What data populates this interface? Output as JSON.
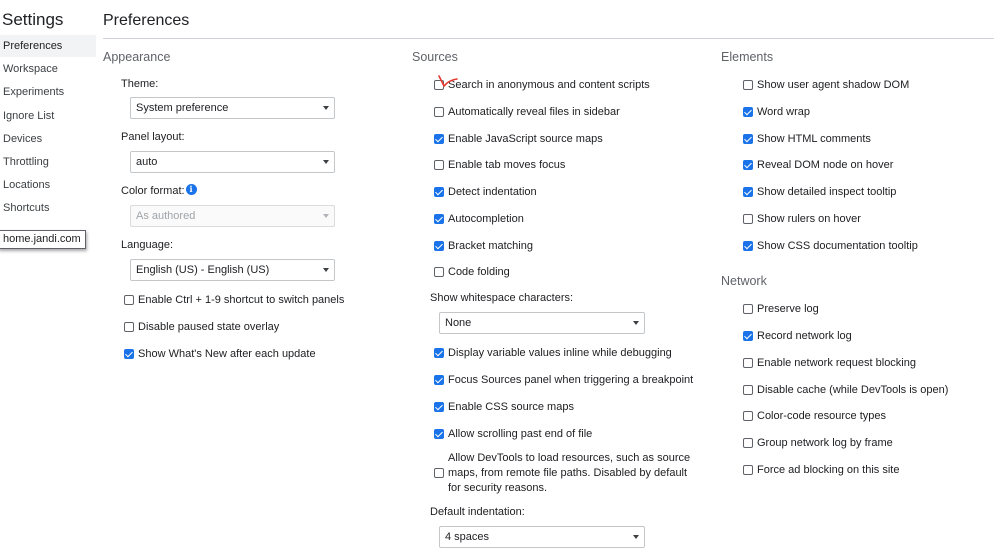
{
  "sidebar": {
    "title": "Settings",
    "items": [
      {
        "label": "Preferences",
        "selected": true
      },
      {
        "label": "Workspace"
      },
      {
        "label": "Experiments"
      },
      {
        "label": "Ignore List"
      },
      {
        "label": "Devices"
      },
      {
        "label": "Throttling"
      },
      {
        "label": "Locations"
      },
      {
        "label": "Shortcuts"
      }
    ],
    "tooltip": "home.jandi.com"
  },
  "page": {
    "title": "Preferences"
  },
  "appearance": {
    "title": "Appearance",
    "theme": {
      "label": "Theme:",
      "value": "System preference"
    },
    "panel_layout": {
      "label": "Panel layout:",
      "value": "auto"
    },
    "color_format": {
      "label": "Color format:",
      "value": "As authored",
      "disabled": true
    },
    "language": {
      "label": "Language:",
      "value": "English (US) - English (US)"
    },
    "checkboxes": [
      {
        "label": "Enable Ctrl + 1-9 shortcut to switch panels",
        "checked": false
      },
      {
        "label": "Disable paused state overlay",
        "checked": false
      },
      {
        "label": "Show What's New after each update",
        "checked": true
      }
    ]
  },
  "sources": {
    "title": "Sources",
    "checkboxes": [
      {
        "label": "Search in anonymous and content scripts",
        "checked": false
      },
      {
        "label": "Automatically reveal files in sidebar",
        "checked": false
      },
      {
        "label": "Enable JavaScript source maps",
        "checked": true
      },
      {
        "label": "Enable tab moves focus",
        "checked": false
      },
      {
        "label": "Detect indentation",
        "checked": true
      },
      {
        "label": "Autocompletion",
        "checked": true
      },
      {
        "label": "Bracket matching",
        "checked": true
      },
      {
        "label": "Code folding",
        "checked": false
      }
    ],
    "whitespace": {
      "label": "Show whitespace characters:",
      "value": "None"
    },
    "checkboxes2": [
      {
        "label": "Display variable values inline while debugging",
        "checked": true
      },
      {
        "label": "Focus Sources panel when triggering a breakpoint",
        "checked": true
      },
      {
        "label": "Enable CSS source maps",
        "checked": true
      },
      {
        "label": "Allow scrolling past end of file",
        "checked": true
      },
      {
        "label": "Allow DevTools to load resources, such as source maps, from remote file paths. Disabled by default for security reasons.",
        "checked": false
      }
    ],
    "indentation": {
      "label": "Default indentation:",
      "value": "4 spaces"
    }
  },
  "elements": {
    "title": "Elements",
    "checkboxes": [
      {
        "label": "Show user agent shadow DOM",
        "checked": false
      },
      {
        "label": "Word wrap",
        "checked": true
      },
      {
        "label": "Show HTML comments",
        "checked": true
      },
      {
        "label": "Reveal DOM node on hover",
        "checked": true
      },
      {
        "label": "Show detailed inspect tooltip",
        "checked": true
      },
      {
        "label": "Show rulers on hover",
        "checked": false
      },
      {
        "label": "Show CSS documentation tooltip",
        "checked": true
      }
    ]
  },
  "network": {
    "title": "Network",
    "checkboxes": [
      {
        "label": "Preserve log",
        "checked": false
      },
      {
        "label": "Record network log",
        "checked": true
      },
      {
        "label": "Enable network request blocking",
        "checked": false
      },
      {
        "label": "Disable cache (while DevTools is open)",
        "checked": false
      },
      {
        "label": "Color-code resource types",
        "checked": false
      },
      {
        "label": "Group network log by frame",
        "checked": false
      },
      {
        "label": "Force ad blocking on this site",
        "checked": false
      }
    ]
  },
  "colors": {
    "accent": "#1a73e8",
    "annotation": "#e8382f",
    "selected_bg": "#f1f3f4"
  },
  "icons": {
    "info": "info-icon",
    "caret": "chevron-down-icon",
    "annotation": "red-check-mark"
  }
}
